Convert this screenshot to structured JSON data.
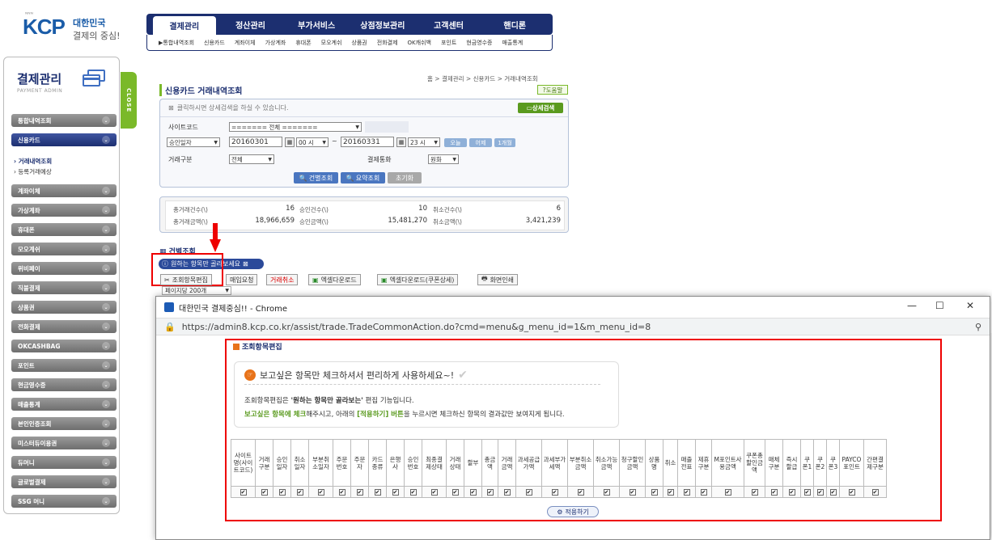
{
  "logo": {
    "brand": "KCP",
    "tagline1": "대한민국",
    "tagline2": "결제의 중심!"
  },
  "topnav": {
    "tabs": [
      "결제관리",
      "정산관리",
      "부가서비스",
      "상점정보관리",
      "고객센터",
      "핸디론"
    ]
  },
  "subnav": {
    "items": [
      "▶통합내역조회",
      "신용카드",
      "계좌이체",
      "가상계좌",
      "휴대폰",
      "모오계쉬",
      "상품권",
      "전화결제",
      "OK캐쉬백",
      "포인트",
      "현금영수증",
      "매출통계"
    ]
  },
  "sidebar": {
    "title": "결제관리",
    "subtitle": "PAYMENT ADMIN",
    "close": "CLOSE",
    "items": [
      "통합내역조회",
      "신용카드",
      "계좌이체",
      "가상계좌",
      "휴대폰",
      "모오계쉬",
      "위비페이",
      "직불결제",
      "상품권",
      "전화결제",
      "OKCASHBAG",
      "포인트",
      "현금영수증",
      "매출통계",
      "본인인증조회",
      "미스터듀이용권",
      "듀머니",
      "글로벌결제",
      "SSG 머니"
    ],
    "subitems": [
      "거래내역조회",
      "등록거래예상"
    ]
  },
  "breadcrumb": "홈 > 결제관리 > 신용카드 > 거래내역조회",
  "page_title": "신용카드 거래내역조회",
  "help_label": "도움말",
  "search": {
    "header": "클릭하시면 상세검색을 하실 수 있습니다.",
    "detail_btn": "상세검색",
    "site_code_label": "사이트코드",
    "site_code_value": "======= 전체 =======",
    "date_type": "승인일자",
    "date_from": "20160301",
    "hour_from": "00 시",
    "tilde": "~",
    "date_to": "20160331",
    "hour_to": "23 시",
    "quick": [
      "오늘",
      "어제",
      "1개월"
    ],
    "tx_type_label": "거래구분",
    "tx_type_value": "전체",
    "currency_label": "결제통화",
    "currency_value": "원화",
    "btn_search": "건별조회",
    "btn_summary": "요약조회",
    "btn_reset": "초기화"
  },
  "summary": {
    "labels": [
      "총거래건수(\\)",
      "승인건수(\\)",
      "취소건수(\\)",
      "총거래금액(\\)",
      "승인금액(\\)",
      "취소금액(\\)"
    ],
    "values": [
      "16",
      "10",
      "6",
      "18,966,659",
      "15,481,270",
      "3,421,239"
    ]
  },
  "list": {
    "title": "건별조회",
    "hint": "원하는 항목만 골라보세요",
    "buttons": [
      "조회항목편집",
      "매입요청",
      "거래취소",
      "엑셀다운로드",
      "엑셀다운로드(쿠폰상세)",
      "화면인쇄"
    ],
    "per_page": "페이지당 200개"
  },
  "popup": {
    "title": "대한민국 결제중심!! - Chrome",
    "url": "https://admin8.kcp.co.kr/assist/trade.TradeCommonAction.do?cmd=menu&g_menu_id=1&m_menu_id=8",
    "heading": "조회항목편집",
    "note_title": "보고싶은 항목만 체크하셔서 편리하게 사용하세요~!",
    "note_p1a": "조회항목편집은 ",
    "note_p1b": "'원하는 항목만 골라보는'",
    "note_p1c": " 편집 기능입니다.",
    "note_p2a": "보고싶은 항목에 체크",
    "note_p2b": "해주시고, 아래의 ",
    "note_p2c": "[적용하기] 버튼",
    "note_p2d": "을 누르시면 체크하신 항목의 결과값만 보여지게 됩니다.",
    "columns": [
      "사이트명(사이트코드)",
      "거래구분",
      "승인일자",
      "취소일자",
      "부분취소일자",
      "주문번호",
      "주문자",
      "카드종류",
      "은행사",
      "승인번호",
      "최종결제상태",
      "거래상태",
      "할부",
      "총금액",
      "거래금액",
      "과세공급가액",
      "과세부가세액",
      "부분취소금액",
      "취소가능금액",
      "청구할인금액",
      "상품명",
      "취소",
      "매출전표",
      "제휴구분",
      "M포인트사용금액",
      "쿠폰총할인금액",
      "매체구분",
      "즉시할급",
      "쿠폰1",
      "쿠폰2",
      "쿠폰3",
      "PAYCO포인트",
      "간편결제구분"
    ],
    "apply": "적용하기",
    "check": "✔"
  },
  "colors": {
    "navy": "#1c2f70",
    "green": "#7ab929",
    "red": "#e00000"
  }
}
